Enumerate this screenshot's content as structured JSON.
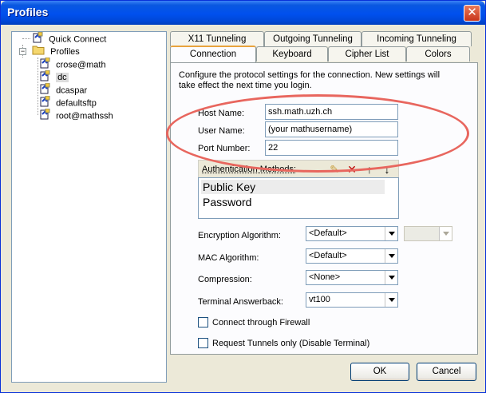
{
  "window": {
    "title": "Profiles",
    "close_glyph": "✕"
  },
  "tree": {
    "items": [
      {
        "label": "Quick Connect",
        "icon": "quick-connect-icon"
      },
      {
        "label": "Profiles",
        "icon": "folder-icon"
      },
      {
        "label": "crose@math",
        "icon": "profile-icon"
      },
      {
        "label": "dc",
        "icon": "profile-icon",
        "selected": true
      },
      {
        "label": "dcaspar",
        "icon": "profile-icon"
      },
      {
        "label": "defaultsftp",
        "icon": "profile-icon"
      },
      {
        "label": "root@mathssh",
        "icon": "profile-icon"
      }
    ],
    "expander_glyph": "−"
  },
  "tabs": {
    "row1": [
      "X11 Tunneling",
      "Outgoing Tunneling",
      "Incoming Tunneling"
    ],
    "row2": [
      "Connection",
      "Keyboard",
      "Cipher List",
      "Colors"
    ],
    "active": "Connection"
  },
  "connection": {
    "description": "Configure the protocol settings for the connection. New settings will take effect the next time you login.",
    "host_label": "Host Name:",
    "host_value": "ssh.math.uzh.ch",
    "user_label": "User Name:",
    "user_value": "(your mathusername)",
    "port_label": "Port Number:",
    "port_value": "22",
    "auth_label": "Authentication Methods:",
    "auth_methods": [
      "Public Key",
      "Password"
    ],
    "auth_toolbar": {
      "new": "✎",
      "delete": "✕",
      "up": "↑",
      "down": "↓"
    },
    "encryption_label": "Encryption Algorithm:",
    "encryption_value": "<Default>",
    "encryption_secondary_value": "",
    "mac_label": "MAC Algorithm:",
    "mac_value": "<Default>",
    "compression_label": "Compression:",
    "compression_value": "<None>",
    "answerback_label": "Terminal Answerback:",
    "answerback_value": "vt100",
    "firewall_label": "Connect through Firewall",
    "tunnels_label": "Request Tunnels only (Disable Terminal)"
  },
  "buttons": {
    "ok": "OK",
    "cancel": "Cancel"
  },
  "colors": {
    "accent": "#e8a33d",
    "titlebar": "#0050ee",
    "highlight": "#e8665e"
  }
}
